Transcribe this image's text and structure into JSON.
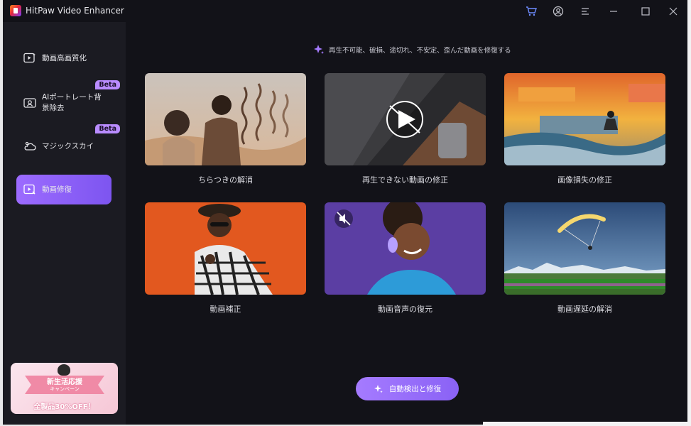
{
  "window": {
    "title": "HitPaw Video Enhancer"
  },
  "titlebar_icons": [
    "cart-icon",
    "user-icon",
    "menu-icon",
    "minimize-icon",
    "maximize-icon",
    "close-icon"
  ],
  "sidebar": {
    "items": [
      {
        "label": "動画高画質化",
        "icon": "video-enhance-icon",
        "active": false
      },
      {
        "label": "AIポートレート背景除去",
        "icon": "portrait-icon",
        "badge": "Beta",
        "active": false
      },
      {
        "label": "マジックスカイ",
        "icon": "sky-icon",
        "badge": "Beta",
        "active": false
      },
      {
        "label": "動画修復",
        "icon": "video-repair-icon",
        "active": true
      }
    ],
    "promo": {
      "title": "新生活応援",
      "subtitle": "キャンペーン",
      "bottom": "全製品30%OFF！"
    }
  },
  "main": {
    "header": "再生不可能、破損、途切れ、不安定、歪んだ動画を修復する",
    "cards": [
      {
        "label": "ちらつきの解消"
      },
      {
        "label": "再生できない動画の修正"
      },
      {
        "label": "画像損失の修正"
      },
      {
        "label": "動画補正"
      },
      {
        "label": "動画音声の復元"
      },
      {
        "label": "動画遅延の解消"
      }
    ],
    "auto_button": "自動検出と修復"
  },
  "colors": {
    "accent": "#9c6bff",
    "window_bg": "#121218",
    "sidebar_bg": "#1b1b22",
    "cart": "#6e8cff"
  }
}
